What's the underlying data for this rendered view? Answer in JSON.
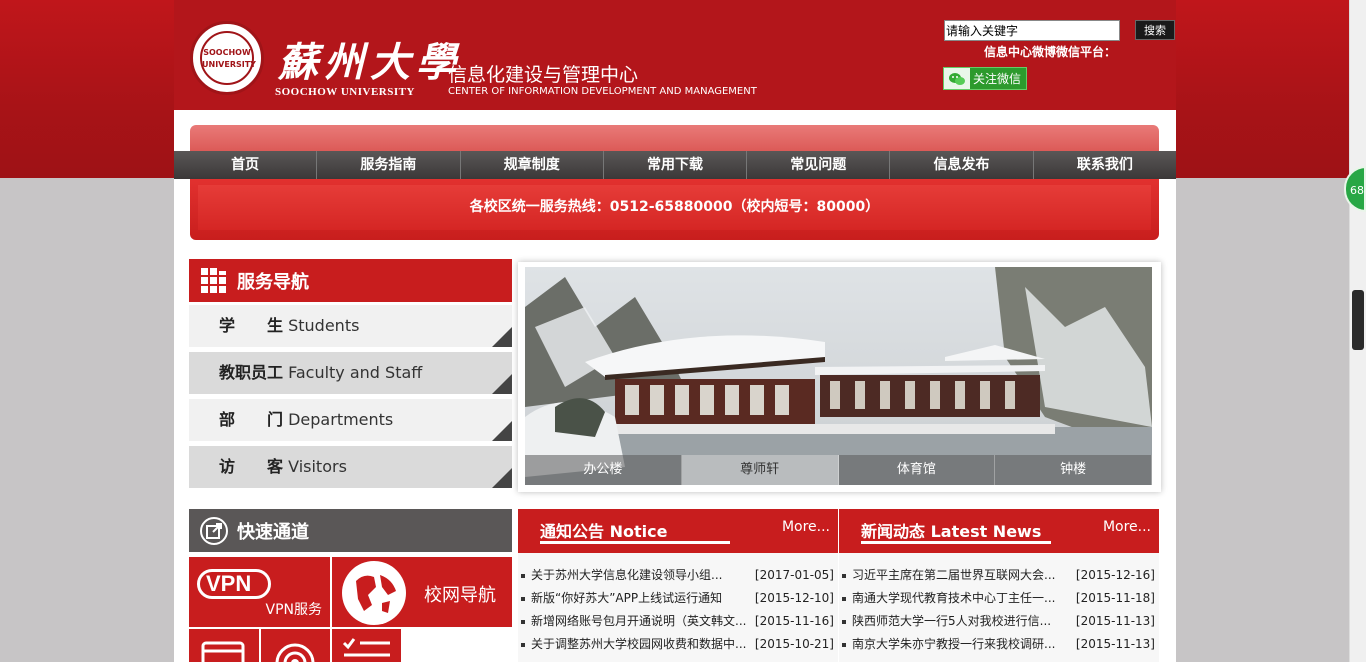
{
  "header": {
    "univ_cn": "蘇州大學",
    "univ_en": "SOOCHOW UNIVERSITY",
    "seal_text": "SOOCHOW UNIVERSITY",
    "center_cn": "信息化建设与管理中心",
    "center_en": "CENTER OF INFORMATION DEVELOPMENT AND MANAGEMENT",
    "search_placeholder": "请输入关键字",
    "search_button": "搜索",
    "wechat_label": "信息中心微博微信平台：",
    "wechat_button": "关注微信"
  },
  "nav": [
    "首页",
    "服务指南",
    "规章制度",
    "常用下载",
    "常见问题",
    "信息发布",
    "联系我们"
  ],
  "hotline": "各校区统一服务热线：0512-65880000（校内短号：80000）",
  "service_nav": {
    "title": "服务导航",
    "items": [
      {
        "cn": "学　　生",
        "en": "Students"
      },
      {
        "cn": "教职员工",
        "en": "Faculty and Staff"
      },
      {
        "cn": "部　　门",
        "en": "Departments"
      },
      {
        "cn": "访　　客",
        "en": "Visitors"
      }
    ]
  },
  "slider": {
    "tabs": [
      "办公楼",
      "尊师轩",
      "体育馆",
      "钟楼"
    ],
    "active_index": 1
  },
  "quick": {
    "title": "快速通道",
    "vpn_logo": "VPN",
    "vpn_label": "VPN服务",
    "campus_nav_label": "校网导航"
  },
  "notice": {
    "title": "通知公告 Notice",
    "more": "More...",
    "items": [
      {
        "title": "关于苏州大学信息化建设领导小组...",
        "date": "[2017-01-05]"
      },
      {
        "title": "新版“你好苏大”APP上线试运行通知",
        "date": "[2015-12-10]"
      },
      {
        "title": "新增网络账号包月开通说明（英文韩文...",
        "date": "[2015-11-16]"
      },
      {
        "title": "关于调整苏州大学校园网收费和数据中...",
        "date": "[2015-10-21]"
      }
    ]
  },
  "news": {
    "title": "新闻动态 Latest News",
    "more": "More...",
    "items": [
      {
        "title": "习近平主席在第二届世界互联网大会...",
        "date": "[2015-12-16]"
      },
      {
        "title": "南通大学现代教育技术中心丁主任一...",
        "date": "[2015-11-18]"
      },
      {
        "title": "陕西师范大学一行5人对我校进行信...",
        "date": "[2015-11-13]"
      },
      {
        "title": "南京大学朱亦宁教授一行来我校调研...",
        "date": "[2015-11-13]"
      }
    ]
  },
  "side_badge": "68"
}
